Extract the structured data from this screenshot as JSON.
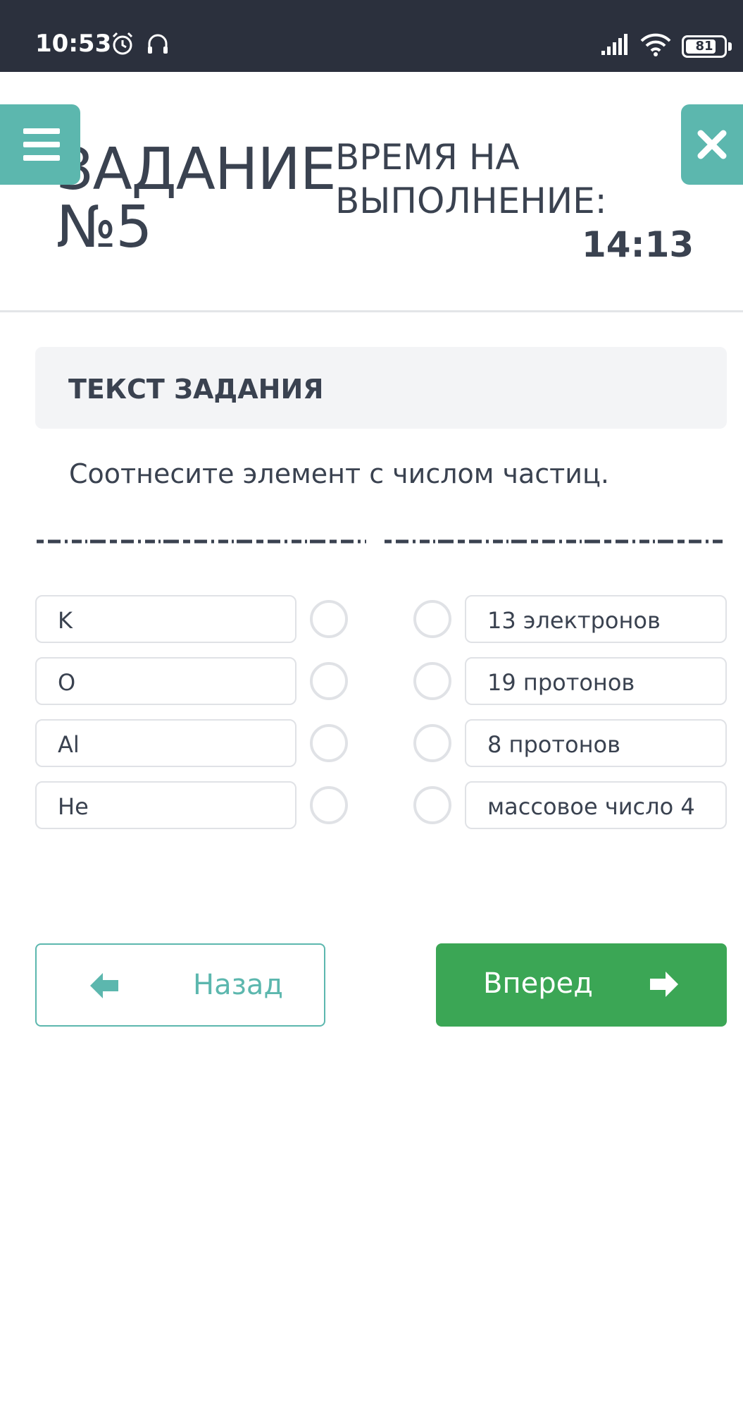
{
  "status_bar": {
    "time": "10:53",
    "battery": "81",
    "icons": [
      "alarm-icon",
      "headphones-icon",
      "signal-icon",
      "wifi-icon",
      "battery-icon"
    ]
  },
  "header": {
    "task_title_line1": "ЗАДАНИЕ",
    "task_title_line2": "№5",
    "time_label_line1": "ВРЕМЯ НА",
    "time_label_line2": "ВЫПОЛНЕНИЕ:",
    "time_value": "14:13",
    "menu_icon": "hamburger-icon",
    "close_icon": "close-icon"
  },
  "task": {
    "section_label": "ТЕКСТ ЗАДАНИЯ",
    "question": "Соотнесите элемент с числом частиц."
  },
  "matching": {
    "left_items": [
      "K",
      "O",
      "Al",
      "He"
    ],
    "right_items": [
      "13 электронов",
      "19 протонов",
      "8 протонов",
      "массовое число 4"
    ]
  },
  "navigation": {
    "back_label": "Назад",
    "next_label": "Вперед"
  },
  "colors": {
    "status_bar": "#2b303d",
    "accent_teal": "#5cb7ae",
    "next_green": "#3ba655",
    "text": "#3a4250"
  }
}
